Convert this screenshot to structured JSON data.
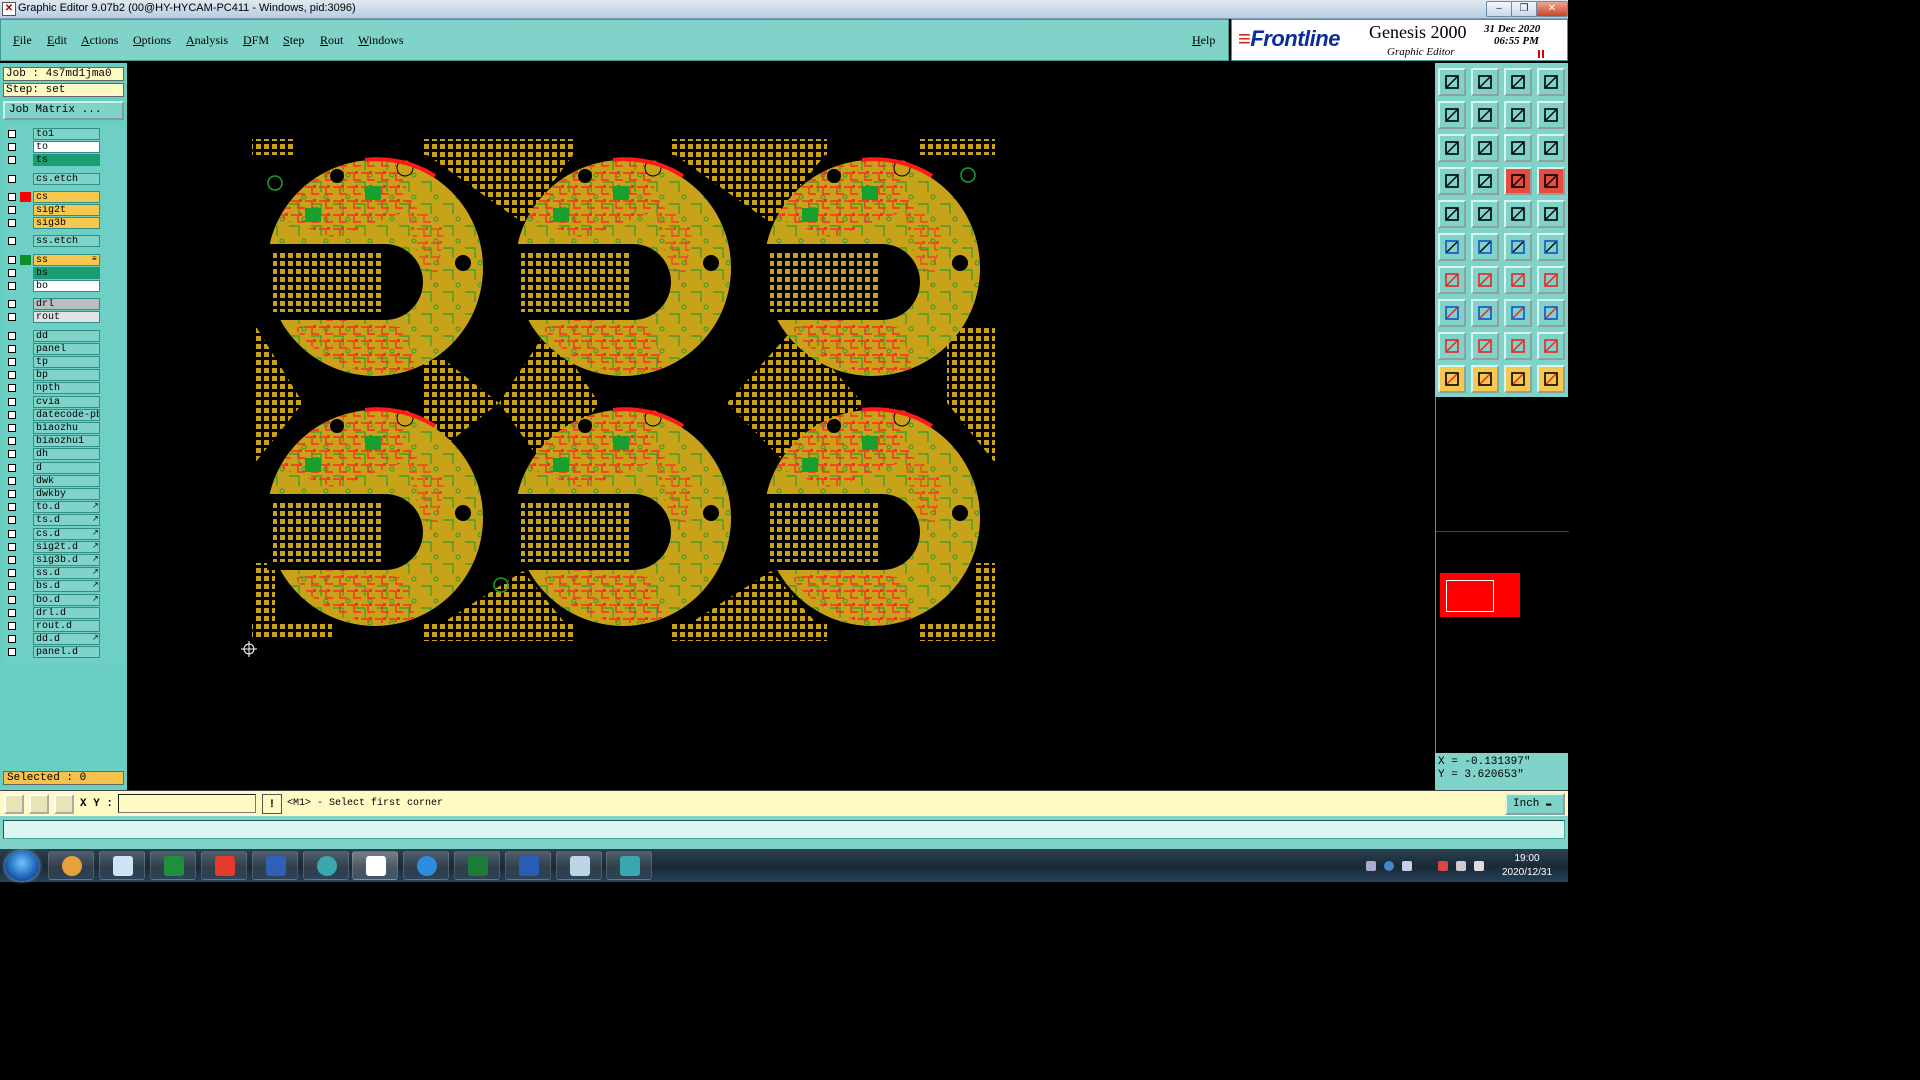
{
  "window": {
    "title": "Graphic Editor 9.07b2 (00@HY-HYCAM-PC411 - Windows, pid:3096)",
    "controls": [
      "minimize",
      "restore",
      "close"
    ]
  },
  "menu": {
    "items": [
      "File",
      "Edit",
      "Actions",
      "Options",
      "Analysis",
      "DFM",
      "Step",
      "Rout",
      "Windows"
    ],
    "help": "Help"
  },
  "brand": {
    "logo": "Frontline",
    "product": "Genesis 2000",
    "subtitle": "Graphic Editor",
    "date": "31 Dec 2020",
    "time": "06:55 PM"
  },
  "job": {
    "job_line": "Job : 4s7md1jma0",
    "step_line": "Step: set",
    "matrix_button": "Job Matrix ..."
  },
  "layers": [
    {
      "name": "to1",
      "bg": "#7fd3c8",
      "swatch": "",
      "flag": ""
    },
    {
      "name": "to",
      "bg": "#ffffff",
      "swatch": "",
      "flag": ""
    },
    {
      "name": "ts",
      "bg": "#1aa070",
      "swatch": "",
      "flag": ""
    },
    {
      "name": "cs.etch",
      "bg": "#7fd3c8",
      "swatch": "",
      "flag": ""
    },
    {
      "name": "cs",
      "bg": "#f7c84f",
      "swatch": "#ff0000",
      "flag": ""
    },
    {
      "name": "sig2t",
      "bg": "#f7c84f",
      "swatch": "",
      "flag": ""
    },
    {
      "name": "sig3b",
      "bg": "#f7c84f",
      "swatch": "",
      "flag": ""
    },
    {
      "name": "ss.etch",
      "bg": "#7fd3c8",
      "swatch": "",
      "flag": ""
    },
    {
      "name": "ss",
      "bg": "#f7c84f",
      "swatch": "#0a8f2d",
      "flag": "≡"
    },
    {
      "name": "bs",
      "bg": "#1aa070",
      "swatch": "",
      "flag": ""
    },
    {
      "name": "bo",
      "bg": "#ffffff",
      "swatch": "",
      "flag": ""
    },
    {
      "name": "drl",
      "bg": "#b9bfc0",
      "swatch": "",
      "flag": ""
    },
    {
      "name": "rout",
      "bg": "#e3e3e3",
      "swatch": "",
      "flag": ""
    },
    {
      "name": "dd",
      "bg": "#7fd3c8",
      "swatch": "",
      "flag": ""
    },
    {
      "name": "panel",
      "bg": "#7fd3c8",
      "swatch": "",
      "flag": ""
    },
    {
      "name": "tp",
      "bg": "#7fd3c8",
      "swatch": "",
      "flag": ""
    },
    {
      "name": "bp",
      "bg": "#7fd3c8",
      "swatch": "",
      "flag": ""
    },
    {
      "name": "npth",
      "bg": "#7fd3c8",
      "swatch": "",
      "flag": ""
    },
    {
      "name": "cvia",
      "bg": "#7fd3c8",
      "swatch": "",
      "flag": ""
    },
    {
      "name": "datecode-pbc",
      "bg": "#7fd3c8",
      "swatch": "",
      "flag": ""
    },
    {
      "name": "biaozhu",
      "bg": "#7fd3c8",
      "swatch": "",
      "flag": ""
    },
    {
      "name": "biaozhu1",
      "bg": "#7fd3c8",
      "swatch": "",
      "flag": ""
    },
    {
      "name": "dh",
      "bg": "#7fd3c8",
      "swatch": "",
      "flag": ""
    },
    {
      "name": "d",
      "bg": "#7fd3c8",
      "swatch": "",
      "flag": ""
    },
    {
      "name": "dwk",
      "bg": "#7fd3c8",
      "swatch": "",
      "flag": ""
    },
    {
      "name": "dwkby",
      "bg": "#7fd3c8",
      "swatch": "",
      "flag": ""
    },
    {
      "name": "to.d",
      "bg": "#7fd3c8",
      "swatch": "",
      "flag": "↗"
    },
    {
      "name": "ts.d",
      "bg": "#7fd3c8",
      "swatch": "",
      "flag": "↗"
    },
    {
      "name": "cs.d",
      "bg": "#7fd3c8",
      "swatch": "",
      "flag": "↗"
    },
    {
      "name": "sig2t.d",
      "bg": "#7fd3c8",
      "swatch": "",
      "flag": "↗"
    },
    {
      "name": "sig3b.d",
      "bg": "#7fd3c8",
      "swatch": "",
      "flag": "↗"
    },
    {
      "name": "ss.d",
      "bg": "#7fd3c8",
      "swatch": "",
      "flag": "↗"
    },
    {
      "name": "bs.d",
      "bg": "#7fd3c8",
      "swatch": "",
      "flag": "↗"
    },
    {
      "name": "bo.d",
      "bg": "#7fd3c8",
      "swatch": "",
      "flag": "↗"
    },
    {
      "name": "drl.d",
      "bg": "#7fd3c8",
      "swatch": "",
      "flag": ""
    },
    {
      "name": "rout.d",
      "bg": "#7fd3c8",
      "swatch": "",
      "flag": ""
    },
    {
      "name": "dd.d",
      "bg": "#7fd3c8",
      "swatch": "",
      "flag": "↗"
    },
    {
      "name": "panel.d",
      "bg": "#7fd3c8",
      "swatch": "",
      "flag": ""
    }
  ],
  "selected": "Selected : 0",
  "canvas": {
    "board_colors": {
      "copper": "#c8a218",
      "trace": "#ff2a2a",
      "silk": "#17a02e",
      "background": "#000000"
    }
  },
  "coords": {
    "x": "X = -0.131397\"",
    "y": "Y = 3.620653\""
  },
  "status": {
    "xy_label": "X Y :",
    "xy_value": "",
    "prompt": "<M1> - Select first corner",
    "unit": "Inch"
  },
  "taskbar": {
    "time": "19:00",
    "date": "2020/12/31"
  }
}
